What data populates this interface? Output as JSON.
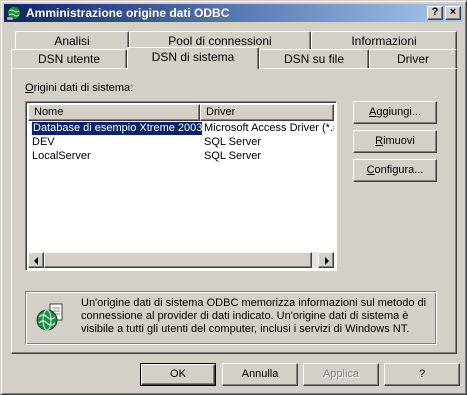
{
  "window": {
    "title": "Amministrazione origine dati ODBC",
    "help_glyph": "?",
    "close_glyph": "×"
  },
  "tabs": {
    "row_back": [
      "Analisi",
      "Pool di connessioni",
      "Informazioni"
    ],
    "row_front": [
      "DSN utente",
      "DSN di sistema",
      "DSN su file",
      "Driver"
    ],
    "active": "DSN di sistema"
  },
  "group": {
    "label_accel": "O",
    "label_rest": "rigini dati di sistema:"
  },
  "list": {
    "columns": [
      "Nome",
      "Driver"
    ],
    "rows": [
      {
        "name": "Database di esempio Xtreme 2003",
        "driver": "Microsoft Access Driver (*.mdb)",
        "selected": true
      },
      {
        "name": "DEV",
        "driver": "SQL Server",
        "selected": false
      },
      {
        "name": "LocalServer",
        "driver": "SQL Server",
        "selected": false
      }
    ]
  },
  "side_buttons": {
    "add": {
      "accel": "A",
      "rest_pre": "",
      "rest": "ggiungi..."
    },
    "remove": {
      "accel": "R",
      "rest": "imuovi"
    },
    "configure": {
      "accel": "C",
      "rest": "onfigura..."
    }
  },
  "info": {
    "text": "Un'origine dati di sistema ODBC memorizza informazioni sul metodo di connessione al provider di dati indicato. Un'origine dati di sistema è visibile a tutti gli utenti del computer, inclusi i servizi di Windows NT."
  },
  "bottom_buttons": {
    "ok": "OK",
    "cancel": "Annulla",
    "apply": "Applica",
    "help": "?"
  },
  "icons": {
    "title": "odbc-globe-icon",
    "info": "odbc-globe-icon"
  }
}
